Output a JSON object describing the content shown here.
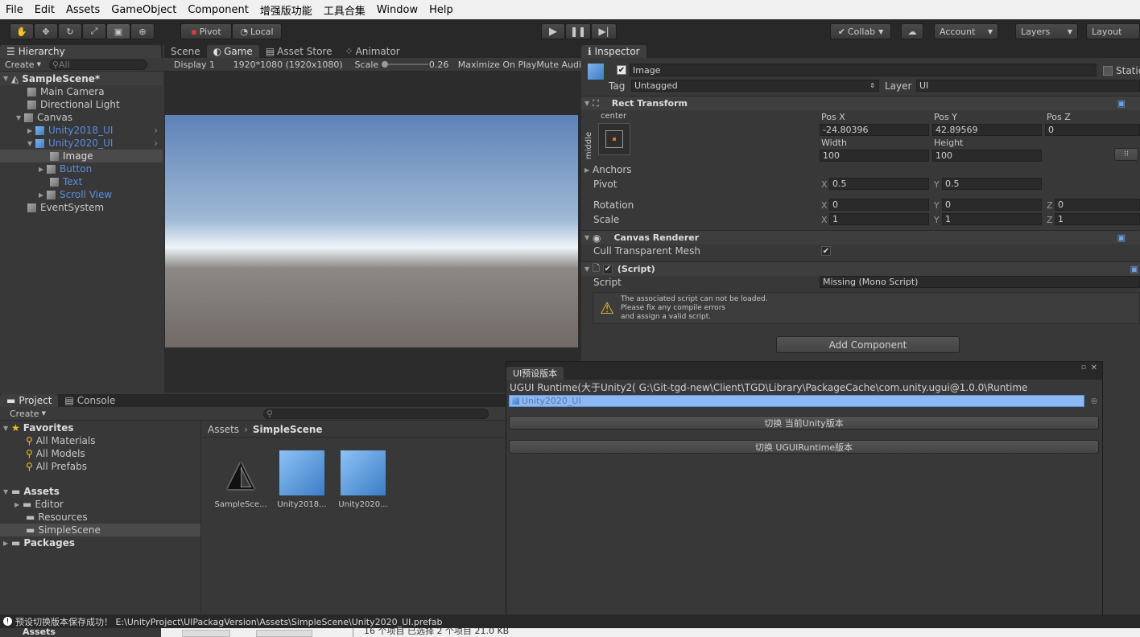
{
  "menu": [
    "File",
    "Edit",
    "Assets",
    "GameObject",
    "Component",
    "增强版功能",
    "工具合集",
    "Window",
    "Help"
  ],
  "toolbar": {
    "pivot": "Pivot",
    "local": "Local",
    "collab": "Collab",
    "account": "Account",
    "layers": "Layers",
    "layout": "Layout"
  },
  "hierarchy": {
    "tab": "Hierarchy",
    "create": "Create",
    "search_placeholder": "All",
    "scene": "SampleScene*",
    "items": [
      "Main Camera",
      "Directional Light",
      "Canvas",
      "Unity2018_UI",
      "Unity2020_UI",
      "Image",
      "Button",
      "Text",
      "Scroll View",
      "EventSystem"
    ]
  },
  "game": {
    "tabs": [
      "Scene",
      "Game",
      "Asset Store",
      "Animator"
    ],
    "display": "Display 1",
    "resolution": "1920*1080 (1920x1080)",
    "scale_label": "Scale",
    "scale_value": "0.26",
    "maximize": "Maximize On Play",
    "mute": "Mute Audi"
  },
  "inspector": {
    "tab": "Inspector",
    "object_name": "Image",
    "static": "Static",
    "tag_label": "Tag",
    "tag_value": "Untagged",
    "layer_label": "Layer",
    "layer_value": "UI",
    "rect_transform": "Rect Transform",
    "anchor_h": "center",
    "anchor_v": "middle",
    "pos_x_label": "Pos X",
    "pos_y_label": "Pos Y",
    "pos_z_label": "Pos Z",
    "pos_x": "-24.80396",
    "pos_y": "42.89569",
    "pos_z": "0",
    "width_label": "Width",
    "height_label": "Height",
    "width": "100",
    "height": "100",
    "anchors": "Anchors",
    "pivot": "Pivot",
    "pivot_x": "0.5",
    "pivot_y": "0.5",
    "rotation": "Rotation",
    "rot_x": "0",
    "rot_y": "0",
    "rot_z": "0",
    "scale": "Scale",
    "scale_x": "1",
    "scale_y": "1",
    "scale_z": "1",
    "x": "X",
    "y": "Y",
    "z": "Z",
    "canvas_renderer": "Canvas Renderer",
    "cull": "Cull Transparent Mesh",
    "script_header": "(Script)",
    "script_label": "Script",
    "script_value": "Missing (Mono Script)",
    "warning_1": "The associated script can not be loaded.",
    "warning_2": "Please fix any compile errors",
    "warning_3": "and assign a valid script.",
    "add_component": "Add Component"
  },
  "project": {
    "tabs": [
      "Project",
      "Console"
    ],
    "create": "Create",
    "favorites": "Favorites",
    "fav_items": [
      "All Materials",
      "All Models",
      "All Prefabs"
    ],
    "assets": "Assets",
    "asset_folders": [
      "Editor",
      "Resources",
      "SimpleScene"
    ],
    "packages": "Packages",
    "breadcrumb_root": "Assets",
    "breadcrumb_current": "SimpleScene",
    "files": [
      "SampleSce...",
      "Unity2018...",
      "Unity2020..."
    ]
  },
  "popup": {
    "title": "UI预设版本",
    "path_line": "UGUI Runtime(大于Unity2( G:\\Git-tgd-new\\Client\\TGD\\Library\\PackageCache\\com.unity.ugui@1.0.0\\Runtime",
    "object_field": "Unity2020_UI",
    "btn1": "切换 当前Unity版本",
    "btn2": "切换 UGUIRuntime版本"
  },
  "status": {
    "message": "预设切换版本保存成功！ E:\\UnityProject\\UIPackagVersion\\Assets\\SimpleScene\\Unity2020_UI.prefab",
    "bottom_left": "Assets",
    "bottom_mid": "16 个项目    已选择 2 个项目 21.0 KB"
  }
}
